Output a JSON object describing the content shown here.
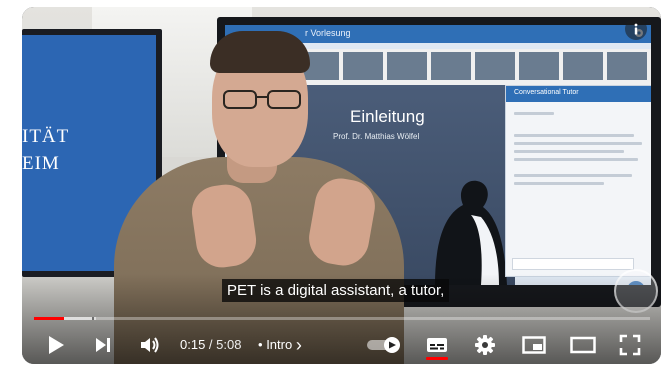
{
  "video": {
    "left_screen_text_line1": "ITÄT",
    "left_screen_text_line2": "EIM",
    "tv_title": "r Vorlesung",
    "slide_title": "Einleitung",
    "slide_subtitle": "Prof. Dr. Matthias Wölfel",
    "tutor_title": "Conversational Tutor"
  },
  "caption": {
    "text": "PET is a digital assistant, a tutor,"
  },
  "progress": {
    "played_fraction": 0.049,
    "buffered_fraction": 0.1
  },
  "controls": {
    "current_time": "0:15",
    "separator": " / ",
    "duration": "5:08",
    "chapter_dot": "•",
    "chapter_label": "Intro",
    "chapter_chevron": "›"
  },
  "icons": {
    "info": "info-icon",
    "play": "play-icon",
    "next": "next-icon",
    "volume": "volume-icon",
    "autoplay": "autoplay-toggle-icon",
    "subtitles": "subtitles-icon",
    "settings": "gear-icon",
    "miniplayer": "miniplayer-icon",
    "theater": "theater-icon",
    "fullscreen": "fullscreen-icon"
  },
  "colors": {
    "progress_played": "#ff0000",
    "cc_active": "#ff0000",
    "tv_accent": "#2f6fb6"
  }
}
